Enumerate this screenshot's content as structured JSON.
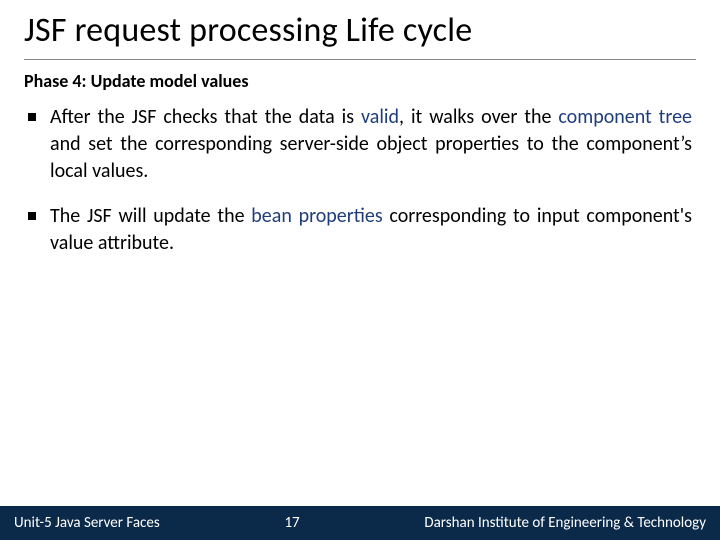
{
  "title": "JSF request processing Life cycle",
  "subtitle": "Phase 4: Update model values",
  "bullets": [
    {
      "pre": "After the JSF checks that the data is ",
      "kw1": "valid",
      "mid1": ", it walks over the ",
      "kw2": "component tree",
      "post": " and set the corresponding server-side object properties to the component’s local values."
    },
    {
      "pre": "The JSF will update the ",
      "kw1": "bean properties",
      "mid1": " corresponding to input component's value attribute.",
      "kw2": "",
      "post": ""
    }
  ],
  "footer": {
    "left": "Unit-5 Java Server Faces",
    "center": "17",
    "right": "Darshan Institute of Engineering & Technology"
  }
}
